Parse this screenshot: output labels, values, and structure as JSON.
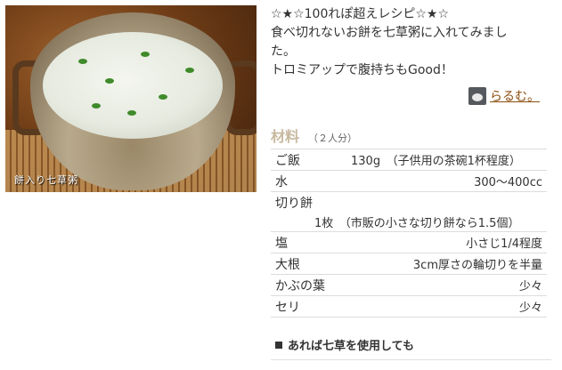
{
  "photo": {
    "caption": "餅入り七草粥"
  },
  "description": {
    "line1": "☆★☆100れぽ超えレシピ☆★☆",
    "line2": "食べ切れないお餅を七草粥に入れてみまし",
    "line3": "た。",
    "line4": "トロミアップで腹持ちもGood！"
  },
  "author": {
    "name": "らるむ。"
  },
  "ingredients": {
    "title": "材料",
    "serves": "（２人分）",
    "items": [
      {
        "name": "ご飯",
        "amount": "130g　（子供用の茶碗1杯程度）"
      },
      {
        "name": "水",
        "amount": "300～400cc"
      },
      {
        "name": "切り餅",
        "amount": "1枚　（市販の小さな切り餅なら1.5個）"
      },
      {
        "name": "塩",
        "amount": "小さじ1/4程度"
      },
      {
        "name": "大根",
        "amount": "3cm厚さの輪切りを半量"
      },
      {
        "name": "かぶの葉",
        "amount": "少々"
      },
      {
        "name": "セリ",
        "amount": "少々"
      }
    ]
  },
  "tip": {
    "text": "あれば七草を使用しても"
  },
  "colors": {
    "author_link": "#8a4d0c",
    "section_title": "#c8b9a0",
    "herb_green": "#3f8a2a"
  }
}
